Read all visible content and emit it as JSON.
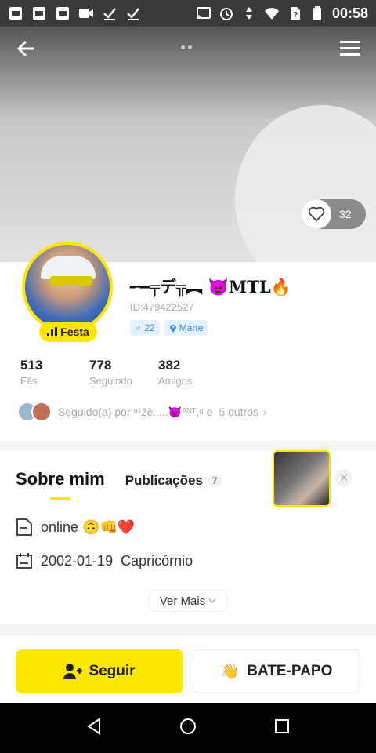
{
  "status_bar": {
    "time": "00:58",
    "left_icons": [
      "photo-notification-icon",
      "photo-notification-icon",
      "photo-notification-icon",
      "video-notification-icon",
      "check-notification-icon",
      "check-notification-icon"
    ],
    "right_icons": [
      "cast-icon",
      "alarm-icon",
      "data-arrows-icon",
      "wifi-icon",
      "no-sim-icon",
      "battery-icon"
    ]
  },
  "header": {
    "back_icon": "arrow-left-icon",
    "menu_icon": "hamburger-menu-icon"
  },
  "cover": {
    "like_count": "32"
  },
  "profile": {
    "badge_label": "Festa",
    "name": "╾━╤デ╦︻ 😈MTL🔥",
    "id_text": "ID:479422527",
    "gender_age": "♂ 22",
    "location": "Marte",
    "stats": [
      {
        "value": "513",
        "label": "Fãs"
      },
      {
        "value": "778",
        "label": "Seguindo"
      },
      {
        "value": "382",
        "label": "Amigos"
      }
    ],
    "followed_by_text": "Seguido(a) por ᵒ¹žē.....😈ᴬᴺᵀ,ᵍ e",
    "followed_more": "5 outros"
  },
  "tabs": {
    "about": "Sobre mim",
    "posts": "Publicações",
    "posts_count": "7"
  },
  "about": {
    "bio": "online 🙃👊❤️",
    "birthday": "2002-01-19",
    "zodiac": "Capricórnio",
    "see_more": "Ver Mais"
  },
  "actions": {
    "follow": "Seguir",
    "chat": "BATE-PAPO",
    "chat_emoji": "👋"
  },
  "colors": {
    "accent": "#ffe600",
    "tag_bg": "#e3f2fd",
    "tag_text": "#3b8de0"
  }
}
